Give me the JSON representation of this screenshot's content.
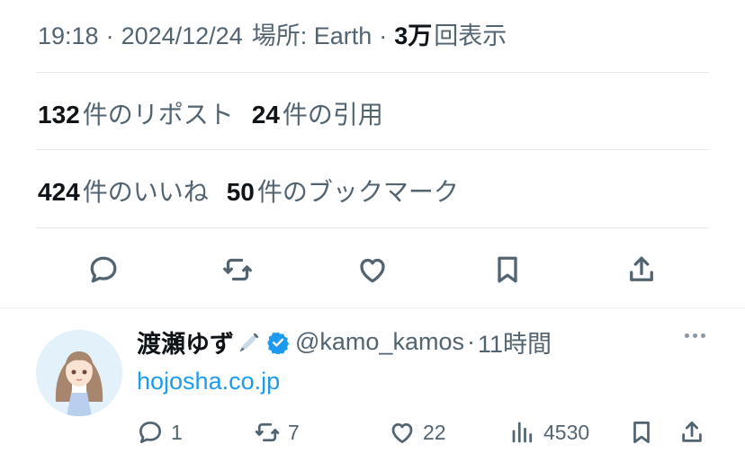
{
  "tweet_meta": {
    "time": "19:18",
    "date": "2024/12/24",
    "location": "場所: Earth",
    "views_count": "3万",
    "views_label": "回表示"
  },
  "stats": {
    "reposts": {
      "count": "132",
      "label": "件のリポスト"
    },
    "quotes": {
      "count": "24",
      "label": "件の引用"
    },
    "likes": {
      "count": "424",
      "label": "件のいいね"
    },
    "bookmarks": {
      "count": "50",
      "label": "件のブックマーク"
    }
  },
  "actions": [
    "reply-icon",
    "repost-icon",
    "like-icon",
    "bookmark-icon",
    "share-icon"
  ],
  "reply": {
    "display_name": "渡瀬ゆず",
    "handle": "@kamo_kamos",
    "separator": "·",
    "time_ago": "11時間",
    "link_text": "hojosha.co.jp",
    "replies": "1",
    "reposts": "7",
    "likes": "22",
    "views": "4530"
  },
  "colors": {
    "text_primary": "#0f1419",
    "text_secondary": "#536471",
    "link": "#1d9bf0",
    "verified": "#1d9bf0",
    "divider": "#e6e9ec"
  }
}
